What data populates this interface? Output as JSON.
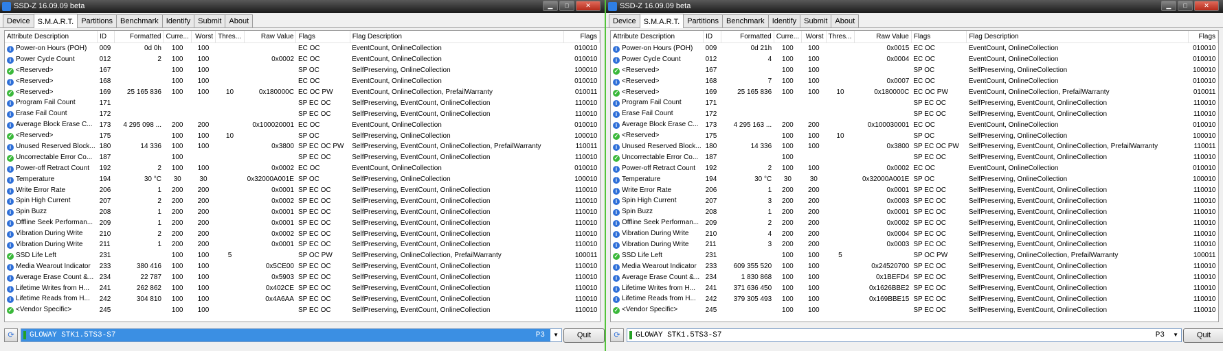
{
  "columns": [
    "Attribute Description",
    "ID",
    "Formatted",
    "Curre...",
    "Worst",
    "Thres...",
    "Raw Value",
    "Flags",
    "Flag Description",
    "Flags"
  ],
  "tabs": [
    "Device",
    "S.M.A.R.T.",
    "Partitions",
    "Benchmark",
    "Identify",
    "Submit",
    "About"
  ],
  "windows": [
    {
      "title": "SSD-Z 16.09.09 beta",
      "active_tab_index": 1,
      "drive": "GLOWAY STK1.5TS3-S7",
      "drive_code": "P3",
      "quit_label": "Quit",
      "rows": [
        [
          "info",
          "Power-on Hours (POH)",
          "009",
          "0d 0h",
          "100",
          "100",
          "",
          "",
          "EC OC",
          "EventCount, OnlineCollection",
          "010010"
        ],
        [
          "info",
          "Power Cycle Count",
          "012",
          "2",
          "100",
          "100",
          "",
          "0x0002",
          "EC OC",
          "EventCount, OnlineCollection",
          "010010"
        ],
        [
          "ok",
          "<Reserved>",
          "167",
          "",
          "100",
          "100",
          "",
          "",
          "SP OC",
          "SelfPreserving, OnlineCollection",
          "100010"
        ],
        [
          "info",
          "<Reserved>",
          "168",
          "",
          "100",
          "100",
          "",
          "",
          "EC OC",
          "EventCount, OnlineCollection",
          "010010"
        ],
        [
          "ok",
          "<Reserved>",
          "169",
          "25 165 836",
          "100",
          "100",
          "10",
          "0x180000C",
          "EC OC PW",
          "EventCount, OnlineCollection, PrefailWarranty",
          "010011"
        ],
        [
          "info",
          "Program Fail Count",
          "171",
          "",
          "",
          "",
          "",
          "",
          "SP EC OC",
          "SelfPreserving, EventCount, OnlineCollection",
          "110010"
        ],
        [
          "info",
          "Erase Fail Count",
          "172",
          "",
          "",
          "",
          "",
          "",
          "SP EC OC",
          "SelfPreserving, EventCount, OnlineCollection",
          "110010"
        ],
        [
          "info",
          "Average Block Erase C...",
          "173",
          "4 295 098 ...",
          "200",
          "200",
          "",
          "0x100020001",
          "EC OC",
          "EventCount, OnlineCollection",
          "010010"
        ],
        [
          "ok",
          "<Reserved>",
          "175",
          "",
          "100",
          "100",
          "10",
          "",
          "SP OC",
          "SelfPreserving, OnlineCollection",
          "100010"
        ],
        [
          "info",
          "Unused Reserved Block...",
          "180",
          "14 336",
          "100",
          "100",
          "",
          "0x3800",
          "SP EC OC PW",
          "SelfPreserving, EventCount, OnlineCollection, PrefailWarranty",
          "110011"
        ],
        [
          "ok",
          "Uncorrectable Error Co...",
          "187",
          "",
          "100",
          "",
          "",
          "",
          "SP EC OC",
          "SelfPreserving, EventCount, OnlineCollection",
          "110010"
        ],
        [
          "info",
          "Power-off Retract Count",
          "192",
          "2",
          "100",
          "100",
          "",
          "0x0002",
          "EC OC",
          "EventCount, OnlineCollection",
          "010010"
        ],
        [
          "info",
          "Temperature",
          "194",
          "30 °C",
          "30",
          "30",
          "",
          "0x32000A001E",
          "SP OC",
          "SelfPreserving, OnlineCollection",
          "100010"
        ],
        [
          "info",
          "Write Error Rate",
          "206",
          "1",
          "200",
          "200",
          "",
          "0x0001",
          "SP EC OC",
          "SelfPreserving, EventCount, OnlineCollection",
          "110010"
        ],
        [
          "info",
          "Spin High Current",
          "207",
          "2",
          "200",
          "200",
          "",
          "0x0002",
          "SP EC OC",
          "SelfPreserving, EventCount, OnlineCollection",
          "110010"
        ],
        [
          "info",
          "Spin Buzz",
          "208",
          "1",
          "200",
          "200",
          "",
          "0x0001",
          "SP EC OC",
          "SelfPreserving, EventCount, OnlineCollection",
          "110010"
        ],
        [
          "info",
          "Offline Seek Performan...",
          "209",
          "1",
          "200",
          "200",
          "",
          "0x0001",
          "SP EC OC",
          "SelfPreserving, EventCount, OnlineCollection",
          "110010"
        ],
        [
          "info",
          "Vibration During Write",
          "210",
          "2",
          "200",
          "200",
          "",
          "0x0002",
          "SP EC OC",
          "SelfPreserving, EventCount, OnlineCollection",
          "110010"
        ],
        [
          "info",
          "Vibration During Write",
          "211",
          "1",
          "200",
          "200",
          "",
          "0x0001",
          "SP EC OC",
          "SelfPreserving, EventCount, OnlineCollection",
          "110010"
        ],
        [
          "ok",
          "SSD Life Left",
          "231",
          "",
          "100",
          "100",
          "5",
          "",
          "SP OC PW",
          "SelfPreserving, OnlineCollection, PrefailWarranty",
          "100011"
        ],
        [
          "info",
          "Media Wearout Indicator",
          "233",
          "380 416",
          "100",
          "100",
          "",
          "0x5CE00",
          "SP EC OC",
          "SelfPreserving, EventCount, OnlineCollection",
          "110010"
        ],
        [
          "info",
          "Average Erase Count &...",
          "234",
          "22 787",
          "100",
          "100",
          "",
          "0x5903",
          "SP EC OC",
          "SelfPreserving, EventCount, OnlineCollection",
          "110010"
        ],
        [
          "info",
          "Lifetime Writes from H...",
          "241",
          "262 862",
          "100",
          "100",
          "",
          "0x402CE",
          "SP EC OC",
          "SelfPreserving, EventCount, OnlineCollection",
          "110010"
        ],
        [
          "info",
          "Lifetime Reads from H...",
          "242",
          "304 810",
          "100",
          "100",
          "",
          "0x4A6AA",
          "SP EC OC",
          "SelfPreserving, EventCount, OnlineCollection",
          "110010"
        ],
        [
          "ok",
          "<Vendor Specific>",
          "245",
          "",
          "100",
          "100",
          "",
          "",
          "SP EC OC",
          "SelfPreserving, EventCount, OnlineCollection",
          "110010"
        ]
      ]
    },
    {
      "title": "SSD-Z 16.09.09 beta",
      "active_tab_index": 1,
      "drive": "GLOWAY STK1.5TS3-S7",
      "drive_code": "P3",
      "quit_label": "Quit",
      "rows": [
        [
          "info",
          "Power-on Hours (POH)",
          "009",
          "0d 21h",
          "100",
          "100",
          "",
          "0x0015",
          "EC OC",
          "EventCount, OnlineCollection",
          "010010"
        ],
        [
          "info",
          "Power Cycle Count",
          "012",
          "4",
          "100",
          "100",
          "",
          "0x0004",
          "EC OC",
          "EventCount, OnlineCollection",
          "010010"
        ],
        [
          "ok",
          "<Reserved>",
          "167",
          "",
          "100",
          "100",
          "",
          "",
          "SP OC",
          "SelfPreserving, OnlineCollection",
          "100010"
        ],
        [
          "info",
          "<Reserved>",
          "168",
          "7",
          "100",
          "100",
          "",
          "0x0007",
          "EC OC",
          "EventCount, OnlineCollection",
          "010010"
        ],
        [
          "ok",
          "<Reserved>",
          "169",
          "25 165 836",
          "100",
          "100",
          "10",
          "0x180000C",
          "EC OC PW",
          "EventCount, OnlineCollection, PrefailWarranty",
          "010011"
        ],
        [
          "info",
          "Program Fail Count",
          "171",
          "",
          "",
          "",
          "",
          "",
          "SP EC OC",
          "SelfPreserving, EventCount, OnlineCollection",
          "110010"
        ],
        [
          "info",
          "Erase Fail Count",
          "172",
          "",
          "",
          "",
          "",
          "",
          "SP EC OC",
          "SelfPreserving, EventCount, OnlineCollection",
          "110010"
        ],
        [
          "info",
          "Average Block Erase C...",
          "173",
          "4 295 163 ...",
          "200",
          "200",
          "",
          "0x100030001",
          "EC OC",
          "EventCount, OnlineCollection",
          "010010"
        ],
        [
          "ok",
          "<Reserved>",
          "175",
          "",
          "100",
          "100",
          "10",
          "",
          "SP OC",
          "SelfPreserving, OnlineCollection",
          "100010"
        ],
        [
          "info",
          "Unused Reserved Block...",
          "180",
          "14 336",
          "100",
          "100",
          "",
          "0x3800",
          "SP EC OC PW",
          "SelfPreserving, EventCount, OnlineCollection, PrefailWarranty",
          "110011"
        ],
        [
          "ok",
          "Uncorrectable Error Co...",
          "187",
          "",
          "100",
          "",
          "",
          "",
          "SP EC OC",
          "SelfPreserving, EventCount, OnlineCollection",
          "110010"
        ],
        [
          "info",
          "Power-off Retract Count",
          "192",
          "2",
          "100",
          "100",
          "",
          "0x0002",
          "EC OC",
          "EventCount, OnlineCollection",
          "010010"
        ],
        [
          "info",
          "Temperature",
          "194",
          "30 °C",
          "30",
          "30",
          "",
          "0x32000A001E",
          "SP OC",
          "SelfPreserving, OnlineCollection",
          "100010"
        ],
        [
          "info",
          "Write Error Rate",
          "206",
          "1",
          "200",
          "200",
          "",
          "0x0001",
          "SP EC OC",
          "SelfPreserving, EventCount, OnlineCollection",
          "110010"
        ],
        [
          "info",
          "Spin High Current",
          "207",
          "3",
          "200",
          "200",
          "",
          "0x0003",
          "SP EC OC",
          "SelfPreserving, EventCount, OnlineCollection",
          "110010"
        ],
        [
          "info",
          "Spin Buzz",
          "208",
          "1",
          "200",
          "200",
          "",
          "0x0001",
          "SP EC OC",
          "SelfPreserving, EventCount, OnlineCollection",
          "110010"
        ],
        [
          "info",
          "Offline Seek Performan...",
          "209",
          "2",
          "200",
          "200",
          "",
          "0x0002",
          "SP EC OC",
          "SelfPreserving, EventCount, OnlineCollection",
          "110010"
        ],
        [
          "info",
          "Vibration During Write",
          "210",
          "4",
          "200",
          "200",
          "",
          "0x0004",
          "SP EC OC",
          "SelfPreserving, EventCount, OnlineCollection",
          "110010"
        ],
        [
          "info",
          "Vibration During Write",
          "211",
          "3",
          "200",
          "200",
          "",
          "0x0003",
          "SP EC OC",
          "SelfPreserving, EventCount, OnlineCollection",
          "110010"
        ],
        [
          "ok",
          "SSD Life Left",
          "231",
          "",
          "100",
          "100",
          "5",
          "",
          "SP OC PW",
          "SelfPreserving, OnlineCollection, PrefailWarranty",
          "100011"
        ],
        [
          "info",
          "Media Wearout Indicator",
          "233",
          "609 355 520",
          "100",
          "100",
          "",
          "0x24520700",
          "SP EC OC",
          "SelfPreserving, EventCount, OnlineCollection",
          "110010"
        ],
        [
          "info",
          "Average Erase Count &...",
          "234",
          "1 830 868",
          "100",
          "100",
          "",
          "0x1BEFD4",
          "SP EC OC",
          "SelfPreserving, EventCount, OnlineCollection",
          "110010"
        ],
        [
          "info",
          "Lifetime Writes from H...",
          "241",
          "371 636 450",
          "100",
          "100",
          "",
          "0x1626BBE2",
          "SP EC OC",
          "SelfPreserving, EventCount, OnlineCollection",
          "110010"
        ],
        [
          "info",
          "Lifetime Reads from H...",
          "242",
          "379 305 493",
          "100",
          "100",
          "",
          "0x169BBE15",
          "SP EC OC",
          "SelfPreserving, EventCount, OnlineCollection",
          "110010"
        ],
        [
          "ok",
          "<Vendor Specific>",
          "245",
          "",
          "100",
          "100",
          "",
          "",
          "SP EC OC",
          "SelfPreserving, EventCount, OnlineCollection",
          "110010"
        ]
      ]
    }
  ]
}
